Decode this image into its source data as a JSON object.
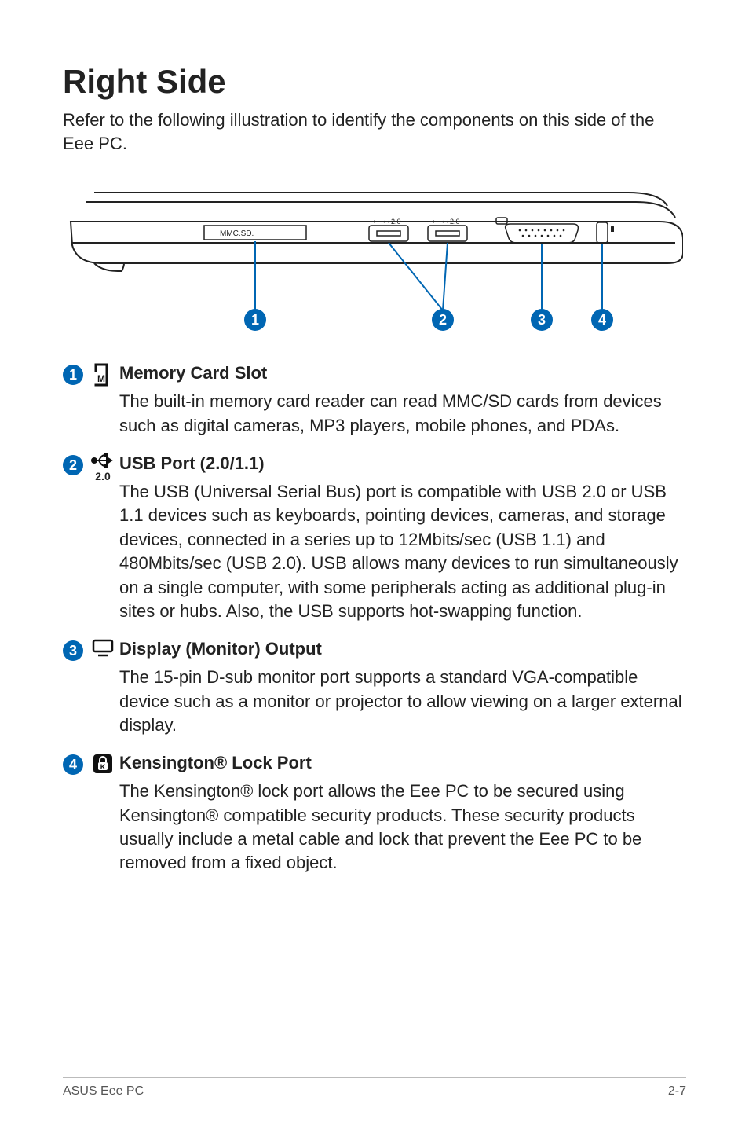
{
  "title": "Right Side",
  "intro": "Refer to the following illustration to identify the components on this side of the Eee PC.",
  "diagram": {
    "port_labels": {
      "mmc": "MMC.SD.",
      "usb": "2.0"
    },
    "callouts": [
      "1",
      "2",
      "3",
      "4"
    ]
  },
  "items": [
    {
      "num": "1",
      "icon_name": "memory-card-icon",
      "heading": "Memory Card Slot",
      "body": "The built-in memory card reader can read MMC/SD cards from devices such as digital cameras, MP3 players, mobile phones, and PDAs."
    },
    {
      "num": "2",
      "icon_name": "usb-icon",
      "icon_sub": "2.0",
      "heading": "USB Port (2.0/1.1)",
      "body": "The USB (Universal Serial Bus) port is compatible with USB 2.0 or USB 1.1 devices such as keyboards, pointing devices, cameras, and storage devices, connected in a series up to 12Mbits/sec (USB 1.1) and 480Mbits/sec (USB 2.0). USB allows many devices to run simultaneously on a single computer, with some peripherals acting as additional plug-in sites or hubs. Also, the USB supports hot-swapping function."
    },
    {
      "num": "3",
      "icon_name": "monitor-icon",
      "heading": "Display (Monitor) Output",
      "body": "The 15-pin D-sub monitor port supports a standard VGA-compatible device such as a monitor or projector to allow viewing on a larger external display."
    },
    {
      "num": "4",
      "icon_name": "lock-icon",
      "heading": "Kensington® Lock Port",
      "body": "The Kensington® lock port allows the Eee PC to be secured using Kensington® compatible security products. These security products usually include a metal cable and lock that prevent the Eee PC to be removed from a fixed object."
    }
  ],
  "footer": {
    "left": "ASUS Eee PC",
    "right": "2-7"
  }
}
